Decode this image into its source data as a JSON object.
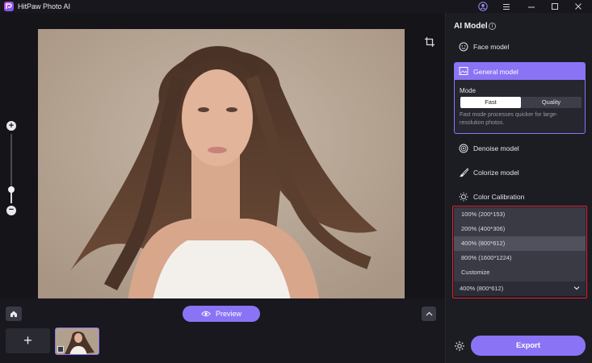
{
  "app": {
    "title": "HitPaw Photo AI"
  },
  "titlebar_icons": [
    "user-icon",
    "menu-icon",
    "minimize-icon",
    "maximize-icon",
    "close-icon"
  ],
  "zoom": {
    "level": 0.2
  },
  "preview": {
    "label": "Preview"
  },
  "panel": {
    "title": "AI Model",
    "models": {
      "face": "Face model",
      "general": "General model",
      "denoise": "Denoise model",
      "colorize": "Colorize model",
      "calibration": "Color Calibration"
    },
    "mode": {
      "label": "Mode",
      "options": [
        "Fast",
        "Quality"
      ],
      "selected": "Fast",
      "description": "Fast mode processes quicker for large-resolution photos."
    },
    "scale": {
      "options": [
        "100% (200*153)",
        "200% (400*306)",
        "400% (800*612)",
        "800% (1600*1224)",
        "Customize"
      ],
      "highlighted_index": 2,
      "selected": "400% (800*612)"
    },
    "export_label": "Export"
  },
  "colors": {
    "accent": "#8a74f5",
    "highlight_box": "#e0242a"
  }
}
